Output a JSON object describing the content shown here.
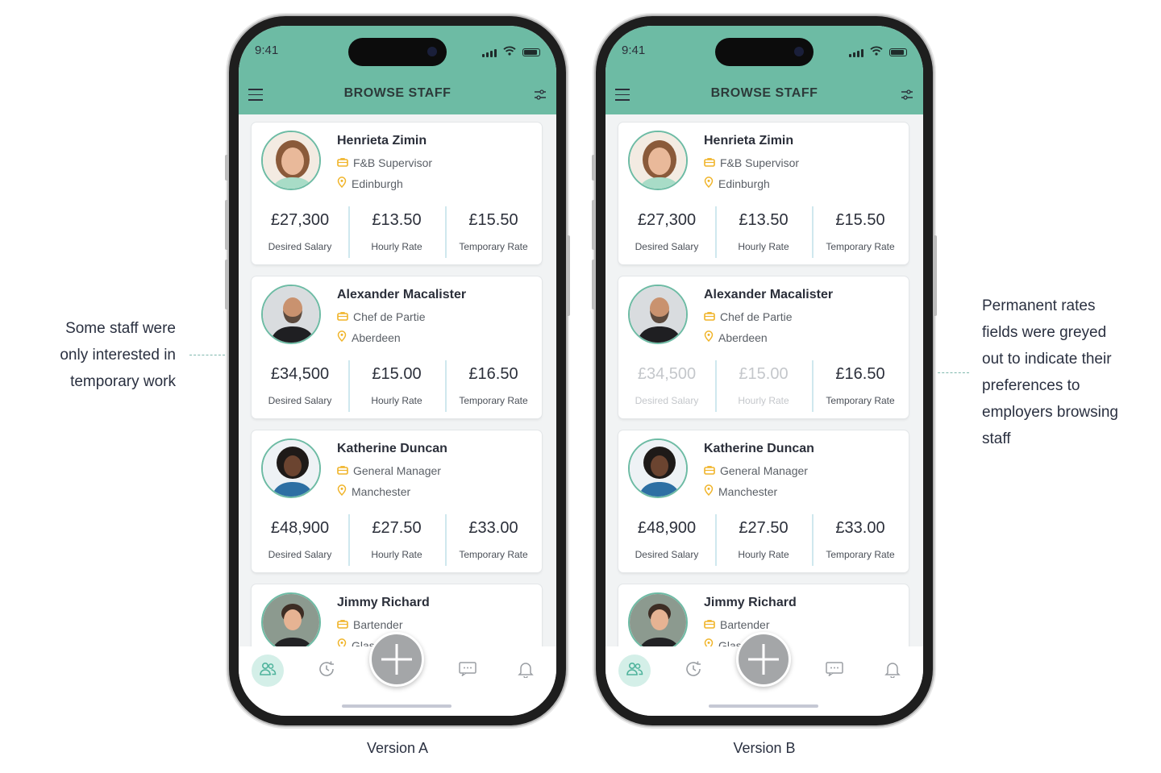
{
  "annotations": {
    "left": [
      "Some staff were",
      "only interested in",
      "temporary work"
    ],
    "right": [
      "Permanent rates",
      "fields were greyed",
      "out to indicate their",
      "preferences to",
      "employers browsing",
      "staff"
    ]
  },
  "colors": {
    "header": "#6dbba4",
    "accent": "#f0b429",
    "greyed": "#c4c7cb"
  },
  "phones": [
    {
      "caption": "Version A",
      "status_time": "9:41",
      "title": "BROWSE STAFF",
      "staff": [
        {
          "name": "Henrieta Zimin",
          "role": "F&B Supervisor",
          "location": "Edinburgh",
          "rates": [
            {
              "value": "£27,300",
              "label": "Desired Salary",
              "greyed": false
            },
            {
              "value": "£13.50",
              "label": "Hourly Rate",
              "greyed": false
            },
            {
              "value": "£15.50",
              "label": "Temporary Rate",
              "greyed": false
            }
          ]
        },
        {
          "name": "Alexander Macalister",
          "role": "Chef de Partie",
          "location": "Aberdeen",
          "rates": [
            {
              "value": "£34,500",
              "label": "Desired Salary",
              "greyed": false
            },
            {
              "value": "£15.00",
              "label": "Hourly Rate",
              "greyed": false
            },
            {
              "value": "£16.50",
              "label": "Temporary Rate",
              "greyed": false
            }
          ]
        },
        {
          "name": "Katherine Duncan",
          "role": "General Manager",
          "location": "Manchester",
          "rates": [
            {
              "value": "£48,900",
              "label": "Desired Salary",
              "greyed": false
            },
            {
              "value": "£27.50",
              "label": "Hourly Rate",
              "greyed": false
            },
            {
              "value": "£33.00",
              "label": "Temporary Rate",
              "greyed": false
            }
          ]
        },
        {
          "name": "Jimmy Richard",
          "role": "Bartender",
          "location": "Glas",
          "rates": []
        }
      ]
    },
    {
      "caption": "Version B",
      "status_time": "9:41",
      "title": "BROWSE STAFF",
      "staff": [
        {
          "name": "Henrieta Zimin",
          "role": "F&B Supervisor",
          "location": "Edinburgh",
          "rates": [
            {
              "value": "£27,300",
              "label": "Desired Salary",
              "greyed": false
            },
            {
              "value": "£13.50",
              "label": "Hourly Rate",
              "greyed": false
            },
            {
              "value": "£15.50",
              "label": "Temporary Rate",
              "greyed": false
            }
          ]
        },
        {
          "name": "Alexander Macalister",
          "role": "Chef de Partie",
          "location": "Aberdeen",
          "rates": [
            {
              "value": "£34,500",
              "label": "Desired Salary",
              "greyed": true
            },
            {
              "value": "£15.00",
              "label": "Hourly Rate",
              "greyed": true
            },
            {
              "value": "£16.50",
              "label": "Temporary Rate",
              "greyed": false
            }
          ]
        },
        {
          "name": "Katherine Duncan",
          "role": "General Manager",
          "location": "Manchester",
          "rates": [
            {
              "value": "£48,900",
              "label": "Desired Salary",
              "greyed": false
            },
            {
              "value": "£27.50",
              "label": "Hourly Rate",
              "greyed": false
            },
            {
              "value": "£33.00",
              "label": "Temporary Rate",
              "greyed": false
            }
          ]
        },
        {
          "name": "Jimmy Richard",
          "role": "Bartender",
          "location": "Glas",
          "rates": []
        }
      ]
    }
  ],
  "tabs": [
    {
      "icon": "people-icon",
      "active": true
    },
    {
      "icon": "history-icon",
      "active": false
    },
    {
      "icon": "add-icon",
      "active": false
    },
    {
      "icon": "message-icon",
      "active": false
    },
    {
      "icon": "bell-icon",
      "active": false
    }
  ]
}
